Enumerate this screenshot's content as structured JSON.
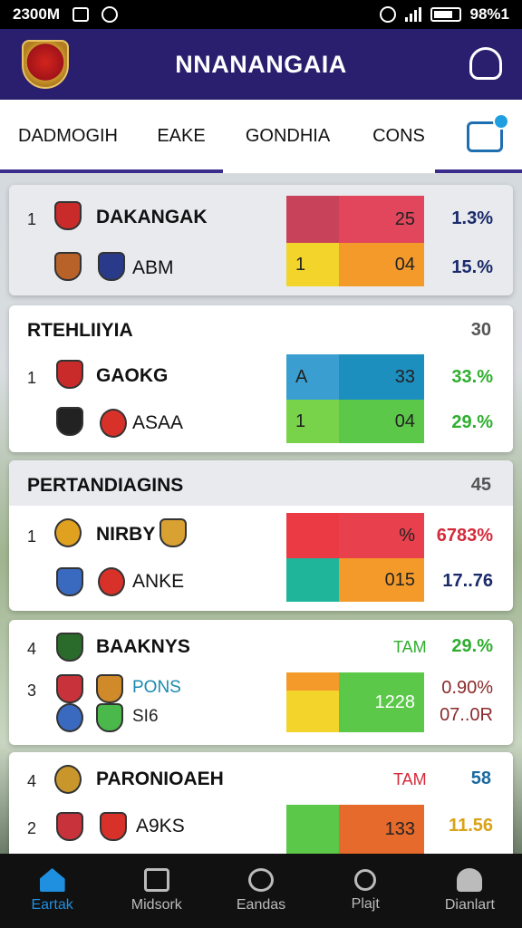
{
  "status_bar": {
    "time": "2300M",
    "battery": "98%1"
  },
  "app_bar": {
    "title": "NNANANGAIA",
    "bell_icon": "bell-icon",
    "logo_icon": "club-crest-logo"
  },
  "tabs": {
    "items": [
      {
        "label": "DADMOGIH"
      },
      {
        "label": "EAKE"
      },
      {
        "label": "GONDHIA"
      },
      {
        "label": "CONS"
      }
    ],
    "calendar_icon": "calendar-icon"
  },
  "cards": [
    {
      "header": "",
      "count": "",
      "rows": [
        {
          "rank": "1",
          "team": "DAKANGAK",
          "cell_left": "",
          "cell_right": "25",
          "pct": "1.3%",
          "left_color": "#c8425a",
          "right_color": "#e1465c",
          "pct_color": "#1a2a6a"
        },
        {
          "rank": "",
          "team": "ABM",
          "cell_left": "1",
          "cell_right": "04",
          "pct": "15.%",
          "left_color": "#f2d42a",
          "right_color": "#f39a2b",
          "pct_color": "#1a2a6a"
        }
      ]
    },
    {
      "header": "RTEHLIIYIA",
      "count": "30",
      "rows": [
        {
          "rank": "1",
          "team": "GAOKG",
          "cell_left": "A",
          "cell_right": "33",
          "pct": "33.%",
          "left_color": "#3a9fd0",
          "right_color": "#1c8fbf",
          "pct_color": "#2fae2f"
        },
        {
          "rank": "",
          "team": "ASAA",
          "cell_left": "1",
          "cell_right": "04",
          "pct": "29.%",
          "left_color": "#79d34a",
          "right_color": "#5bc84a",
          "pct_color": "#2fae2f"
        }
      ]
    },
    {
      "header": "PERTANDIAGINS",
      "count": "45",
      "rows": [
        {
          "rank": "1",
          "team": "NIRBY",
          "cell_left": "",
          "cell_right": "%",
          "pct": "6783%",
          "left_color": "#ec3a44",
          "right_color": "#e8404c",
          "pct_color": "#d42a3a"
        },
        {
          "rank": "",
          "team": "ANKE",
          "cell_left": "",
          "cell_right": "015",
          "pct": "17..76",
          "left_color": "#1eb59a",
          "right_color": "#f39a2b",
          "pct_color": "#1a2a6a"
        }
      ]
    },
    {
      "header": "",
      "count": "",
      "rows": [
        {
          "rank": "4",
          "team": "BAAKNYS",
          "tag": "TAM",
          "pct": "29.%",
          "pct_color": "#2fae2f"
        },
        {
          "rank": "3",
          "team": "PONS",
          "team2": "SI6",
          "cell_left": "",
          "cell_right": "1228",
          "pct": "0.90%",
          "pct2": "07..0R",
          "left_color": "#f39a2b",
          "right_color": "#5bc84a",
          "pct_color": "#8a2a2a",
          "pct2_color": "#8a2a2a"
        }
      ]
    },
    {
      "header": "",
      "count": "58",
      "rows": [
        {
          "rank": "4",
          "team": "PARONIOAEH",
          "tag": "TAM",
          "pct": ""
        },
        {
          "rank": "2",
          "team": "A9KS",
          "cell_left": "",
          "cell_right": "133",
          "pct": "11.56",
          "left_color": "#5bc84a",
          "right_color": "#e66a2b",
          "pct_color": "#d9a21a"
        }
      ]
    }
  ],
  "bottom_nav": [
    {
      "label": "Eartak",
      "icon": "home-icon"
    },
    {
      "label": "Midsork",
      "icon": "stadium-icon"
    },
    {
      "label": "Eandas",
      "icon": "ball-icon"
    },
    {
      "label": "Plajt",
      "icon": "search-icon"
    },
    {
      "label": "Dianlart",
      "icon": "person-icon"
    }
  ]
}
